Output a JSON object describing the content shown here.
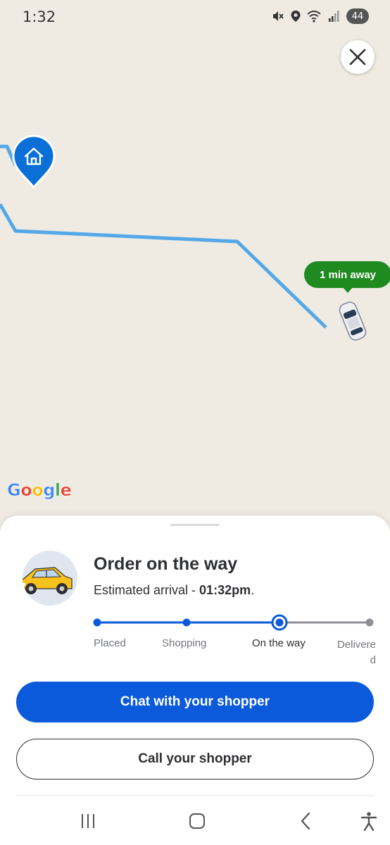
{
  "status_bar": {
    "time": "1:32",
    "battery": "44",
    "icons": [
      "mute-icon",
      "location-icon",
      "wifi-icon",
      "signal-icon"
    ]
  },
  "map": {
    "eta_label": "1 min away",
    "google_letters": [
      "G",
      "o",
      "o",
      "g",
      "l",
      "e"
    ],
    "route_color": "#54a8e8",
    "pin_color": "#0a6fd6",
    "eta_color": "#1f8a1f"
  },
  "order": {
    "title": "Order on the way",
    "eta_prefix": "Estimated arrival - ",
    "eta_time": "01:32pm",
    "eta_suffix": ".",
    "steps": [
      {
        "label": "Placed",
        "state": "done"
      },
      {
        "label": "Shopping",
        "state": "done"
      },
      {
        "label": "On the way",
        "state": "current"
      },
      {
        "label": "Delivered",
        "state": "pending"
      }
    ],
    "progress_color": "#0a5adb"
  },
  "actions": {
    "chat_label": "Chat with your shopper",
    "call_label": "Call your shopper"
  },
  "nav": {
    "items": [
      "recent-apps-icon",
      "home-icon",
      "back-icon",
      "accessibility-icon"
    ]
  }
}
